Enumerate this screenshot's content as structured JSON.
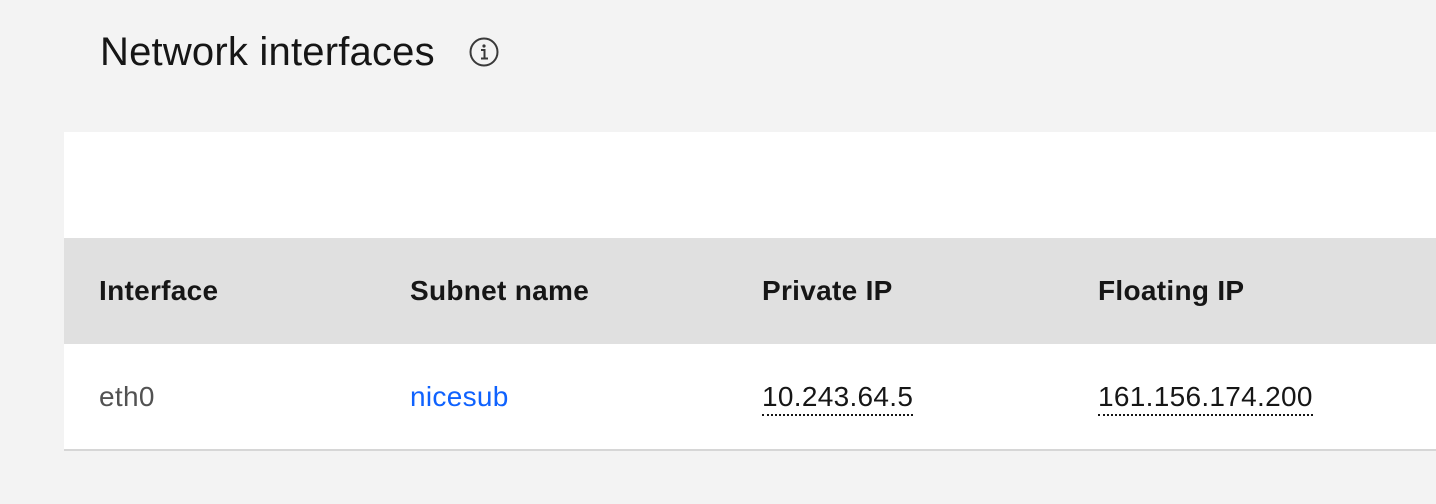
{
  "section": {
    "title": "Network interfaces",
    "info_icon": "information-icon"
  },
  "table": {
    "headers": {
      "interface": "Interface",
      "subnet": "Subnet name",
      "private_ip": "Private IP",
      "floating_ip": "Floating IP"
    },
    "rows": [
      {
        "interface": "eth0",
        "subnet": "nicesub",
        "private_ip": "10.243.64.5",
        "floating_ip": "161.156.174.200"
      }
    ]
  },
  "colors": {
    "page_bg": "#f3f3f3",
    "header_bg": "#e0e0e0",
    "link": "#0f62fe"
  }
}
